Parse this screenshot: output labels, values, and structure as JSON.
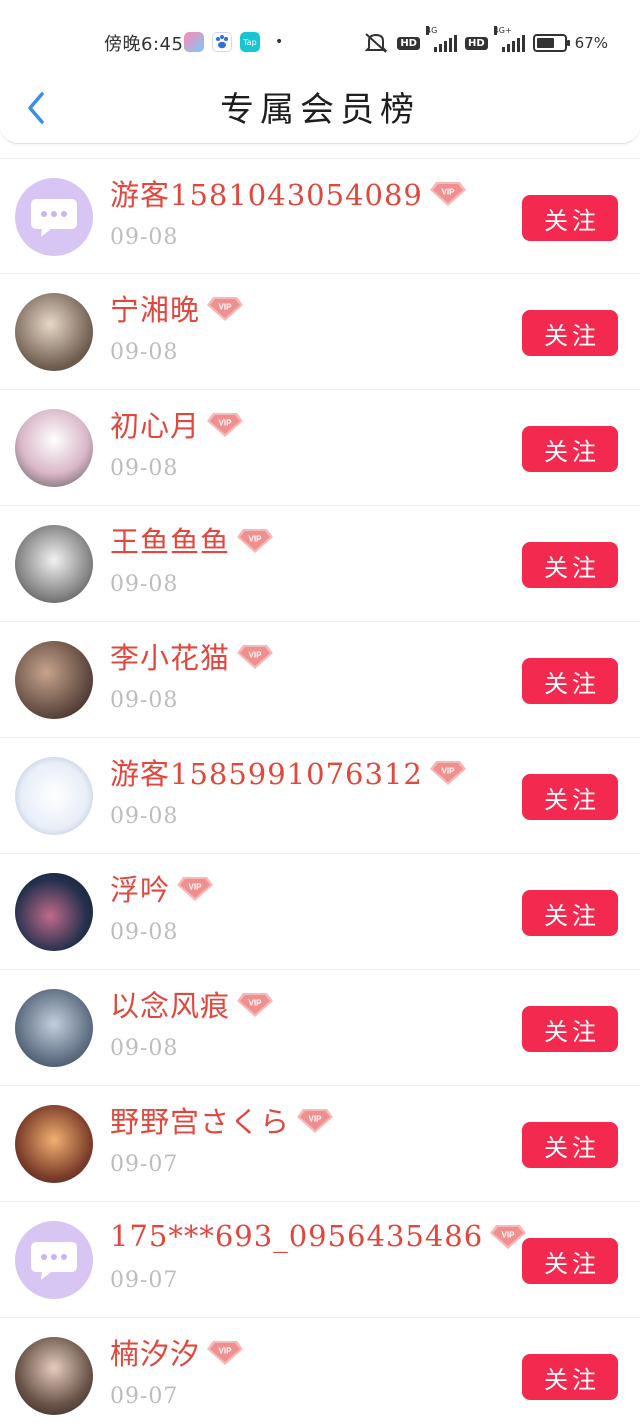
{
  "status_bar": {
    "time": "傍晚6:45",
    "hd1": "HD",
    "net1": "4G",
    "hd2": "HD",
    "net2": "4G+",
    "battery": "67%",
    "battery_level": 0.67
  },
  "header": {
    "title": "专属会员榜",
    "back_icon": "chevron-left-icon"
  },
  "colors": {
    "accent": "#f4294f",
    "name": "#e0483e",
    "date": "#bdbdbd",
    "back": "#3a8ee6"
  },
  "members": [
    {
      "name": "游客15810430540​89",
      "date": "09-08",
      "button": "关注",
      "avatar": "default-chat-avatar"
    },
    {
      "name": "宁湘晚",
      "date": "09-08",
      "button": "关注",
      "avatar": "photo-avatar"
    },
    {
      "name": "初心月",
      "date": "09-08",
      "button": "关注",
      "avatar": "photo-avatar"
    },
    {
      "name": "王鱼鱼鱼",
      "date": "09-08",
      "button": "关注",
      "avatar": "photo-avatar"
    },
    {
      "name": "李小花猫",
      "date": "09-08",
      "button": "关注",
      "avatar": "photo-avatar"
    },
    {
      "name": "游客15859910763​12",
      "date": "09-08",
      "button": "关注",
      "avatar": "photo-avatar"
    },
    {
      "name": "浮吟",
      "date": "09-08",
      "button": "关注",
      "avatar": "photo-avatar"
    },
    {
      "name": "以念风痕",
      "date": "09-08",
      "button": "关注",
      "avatar": "photo-avatar"
    },
    {
      "name": "野野宫さくら",
      "date": "09-07",
      "button": "关注",
      "avatar": "photo-avatar"
    },
    {
      "name": "175***693_0956435486",
      "date": "09-07",
      "button": "关注",
      "avatar": "default-chat-avatar"
    },
    {
      "name": "楠汐汐",
      "date": "09-07",
      "button": "关注",
      "avatar": "photo-avatar"
    }
  ]
}
